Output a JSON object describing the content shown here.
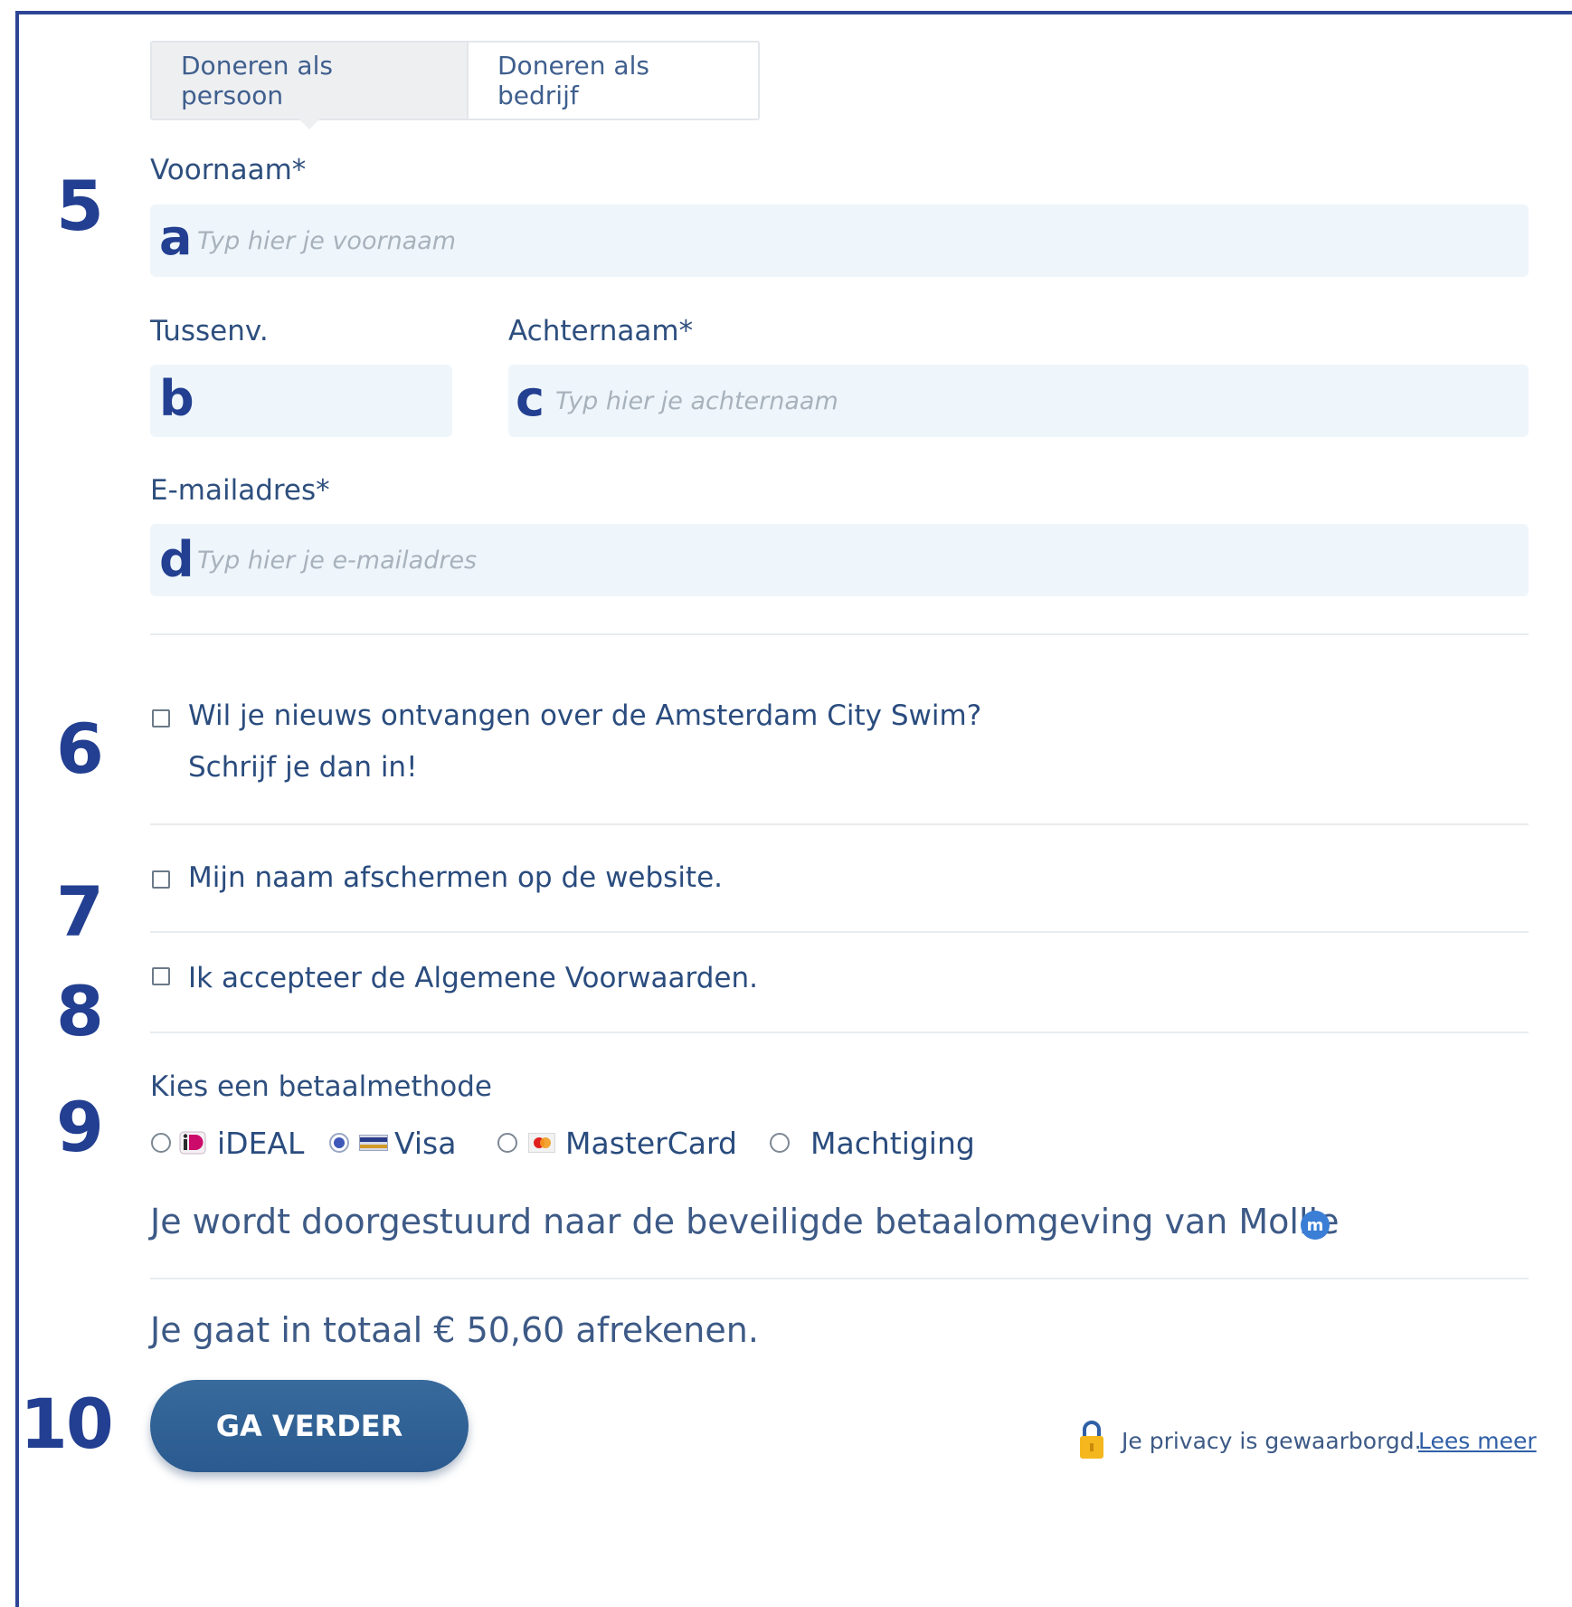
{
  "tabs": [
    {
      "label": "Doneren als persoon",
      "active": true
    },
    {
      "label": "Doneren als bedrijf",
      "active": false
    }
  ],
  "form": {
    "voornaam": {
      "label": "Voornaam*",
      "placeholder": "Typ hier je voornaam",
      "value": ""
    },
    "tussenvoegsel": {
      "label": "Tussenv.",
      "placeholder": "",
      "value": ""
    },
    "achternaam": {
      "label": "Achternaam*",
      "placeholder": "Typ hier je achternaam",
      "value": ""
    },
    "email": {
      "label": "E-mailadres*",
      "placeholder": "Typ hier je e-mailadres",
      "value": ""
    }
  },
  "checkboxes": {
    "newsletter": {
      "line1": "Wil je nieuws ontvangen over de Amsterdam City Swim?",
      "line2": "Schrijf je dan in!",
      "checked": false
    },
    "anonymous": {
      "label": "Mijn naam afschermen op de website.",
      "checked": false
    },
    "terms": {
      "label": "Ik accepteer de Algemene Voorwaarden.",
      "checked": false
    }
  },
  "payment": {
    "title": "Kies een betaalmethode",
    "methods": [
      {
        "label": "iDEAL",
        "icon": "ideal-icon",
        "selected": false
      },
      {
        "label": "Visa",
        "icon": "visa-card-icon",
        "selected": true
      },
      {
        "label": "MasterCard",
        "icon": "mastercard-icon",
        "selected": false
      },
      {
        "label": "Machtiging",
        "icon": "",
        "selected": false
      }
    ],
    "redirect_text": "Je wordt doorgestuurd naar de beveiligde betaalomgeving van Mollie",
    "mollie_icon_glyph": "m"
  },
  "total_text": "Je gaat in totaal € 50,60 afrekenen.",
  "submit_label": "GA VERDER",
  "privacy": {
    "text": "Je privacy is gewaarborgd.",
    "link": "Lees meer"
  },
  "annotations": {
    "numbers": [
      "5",
      "6",
      "7",
      "8",
      "9",
      "10"
    ],
    "letters": [
      "a",
      "b",
      "c",
      "d"
    ],
    "color": "#233f91"
  },
  "colors": {
    "frame": "#2d4594",
    "field_bg": "#eef6fb",
    "button": "#2f5f92",
    "text": "#2e4f7e"
  }
}
